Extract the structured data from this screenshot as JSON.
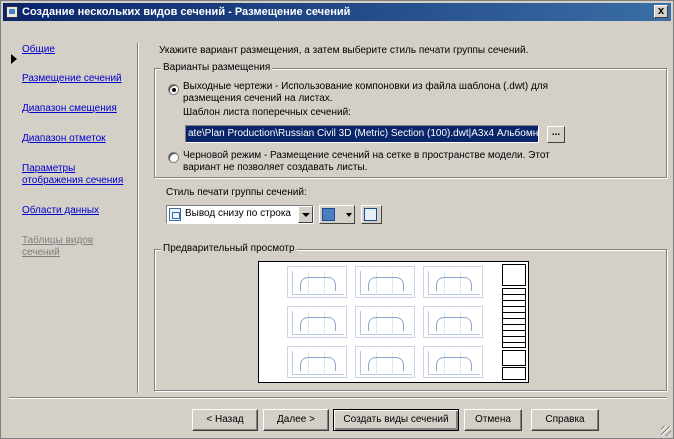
{
  "window": {
    "title": "Создание нескольких видов сечений - Размещение сечений",
    "close_label": "x"
  },
  "nav": {
    "items": [
      {
        "label": "Общие"
      },
      {
        "label": "Размещение сечений",
        "current": true
      },
      {
        "label": "Диапазон смещения"
      },
      {
        "label": "Диапазон отметок"
      },
      {
        "label": "Параметры",
        "label2": "отображения сечения"
      },
      {
        "label": "Области данных"
      },
      {
        "label": "Таблицы видов",
        "label2": "сечений",
        "disabled": true
      }
    ]
  },
  "instruction": "Укажите вариант размещения, а затем выберите стиль печати группы сечений.",
  "placement": {
    "legend": "Варианты размещения",
    "option_sheets": {
      "line1": "Выходные чертежи - Использование компоновки из файла шаблона (.dwt) для",
      "line2": "размещения сечений на листах.",
      "checked": true
    },
    "template_label": "Шаблон листа поперечных сечений:",
    "template_value": "ate\\Plan Production\\Russian Civil 3D (Metric) Section (100).dwt|A3x4 Альбомная",
    "browse_label": "...",
    "option_draft": {
      "line1": "Черновой режим - Размещение сечений на сетке в пространстве модели. Этот",
      "line2": "вариант не позволяет создавать листы.",
      "checked": false
    }
  },
  "print_style": {
    "label": "Стиль печати группы сечений:",
    "selected": "Вывод снизу по строка"
  },
  "preview": {
    "legend": "Предварительный просмотр"
  },
  "buttons": {
    "back": "< Назад",
    "next": "Далее >",
    "create": "Создать виды сечений",
    "cancel": "Отмена",
    "help": "Справка"
  }
}
